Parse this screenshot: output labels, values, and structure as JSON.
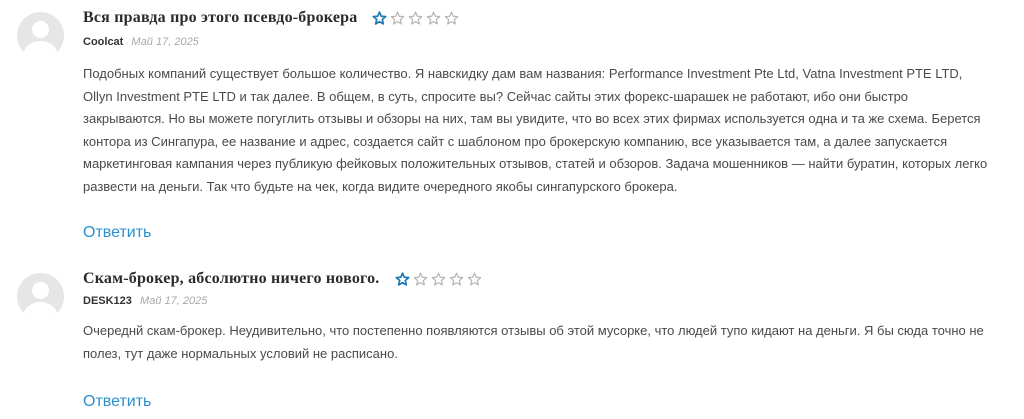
{
  "reviews": [
    {
      "title": "Вся правда про этого псевдо-брокера",
      "author": "Coolcat",
      "date": "Май 17, 2025",
      "rating": 1,
      "rating_max": 5,
      "text": "Подобных компаний существует большое количество. Я навскидку дам вам названия: Performance Investment Pte Ltd, Vatna Investment PTE LTD, Ollyn Investment PTE LTD и так далее. В общем, в суть, спросите вы? Сейчас сайты этих форекс-шарашек не работают, ибо они быстро закрываются. Но вы можете погуглить отзывы и обзоры на них, там вы увидите, что во всех этих фирмах используется одна и та же схема. Берется контора из Сингапура, ее название и адрес, создается сайт с шаблоном про брокерскую компанию, все указывается там, а далее запускается маркетинговая кампания через публикую фейковых положительных отзывов, статей и обзоров. Задача мошенников — найти буратин, которых легко развести на деньги. Так что будьте на чек, когда видите очередного якобы сингапурского брокера.",
      "reply_label": "Ответить"
    },
    {
      "title": "Скам-брокер, абсолютно ничего нового.",
      "author": "DESK123",
      "date": "Май 17, 2025",
      "rating": 1,
      "rating_max": 5,
      "text": "Очереднй скам-брокер. Неудивительно, что постепенно появляются отзывы об этой мусорке, что людей тупо кидают на деньги. Я бы сюда точно не полез, тут даже нормальных условий не расписано.",
      "reply_label": "Ответить"
    }
  ],
  "colors": {
    "star_filled": "#1f78b4",
    "star_empty": "#b5b5b5",
    "reply_link": "#2a8fd1"
  }
}
